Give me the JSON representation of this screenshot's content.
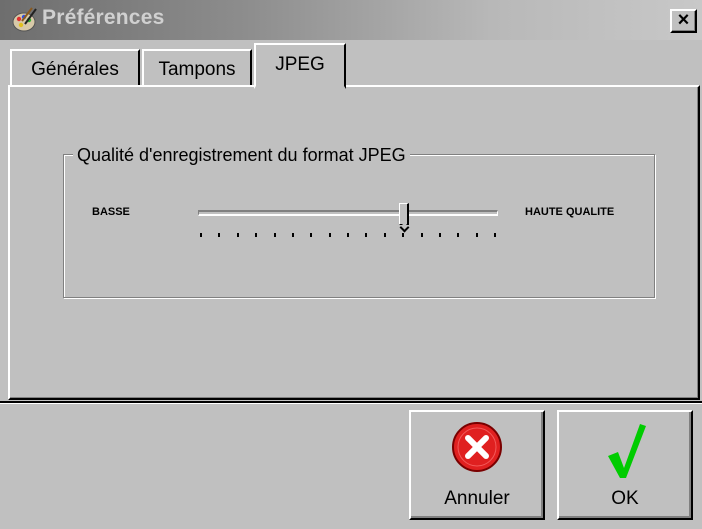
{
  "window": {
    "title": "Préférences"
  },
  "tabs": [
    {
      "label": "Générales",
      "active": false
    },
    {
      "label": "Tampons",
      "active": false
    },
    {
      "label": "JPEG",
      "active": true
    }
  ],
  "jpeg_quality": {
    "group_title": "Qualité d'enregistrement du format JPEG",
    "low_label": "BASSE",
    "high_label": "HAUTE QUALITE",
    "slider_fraction": 0.69,
    "tick_count": 17
  },
  "buttons": {
    "cancel_label": "Annuler",
    "ok_label": "OK"
  },
  "icons": {
    "app": "painter-palette-icon",
    "close": "close-icon",
    "cancel": "red-x-circle-icon",
    "ok": "green-checkmark-icon"
  },
  "colors": {
    "cancel_icon": "#e02020",
    "ok_icon": "#00cc00"
  }
}
